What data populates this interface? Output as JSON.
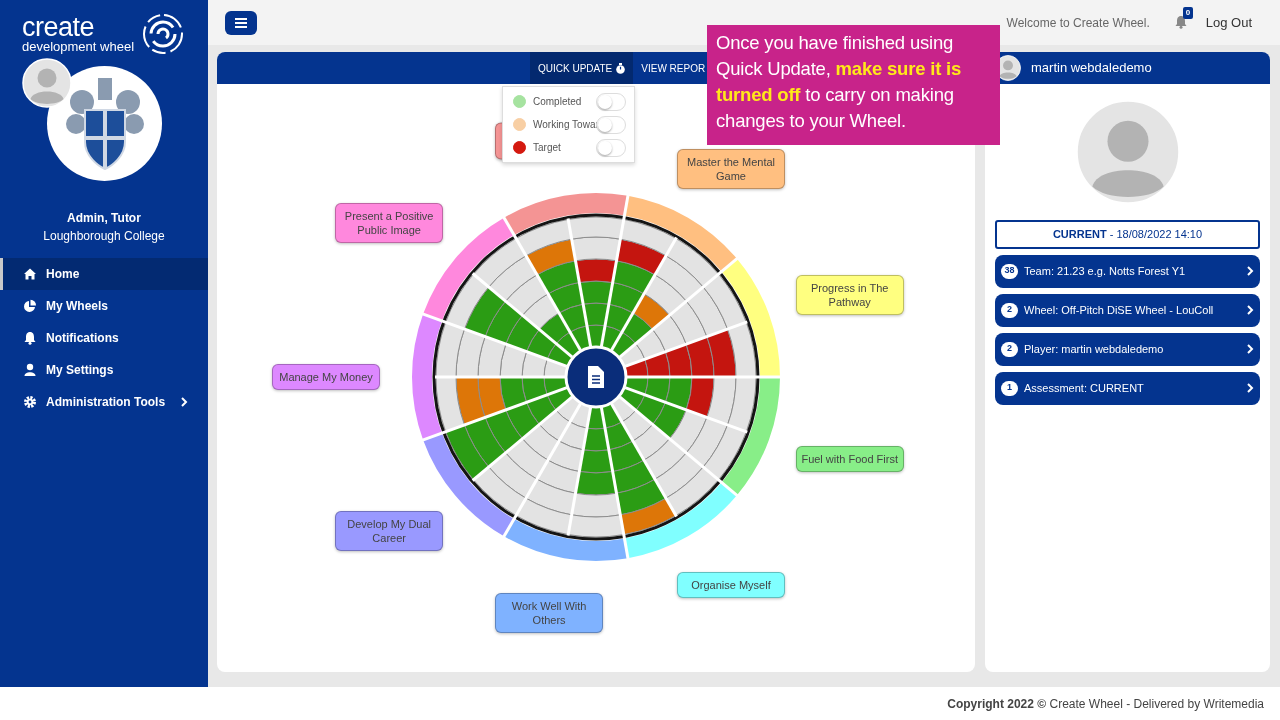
{
  "sidebar": {
    "logo": {
      "line_1": "create",
      "line_2": "development wheel"
    },
    "user": {
      "name": "Admin, Tutor",
      "organisation": "Loughborough College"
    },
    "items": [
      {
        "label": "Home",
        "kind": "home",
        "selected": true,
        "has_submenu": false
      },
      {
        "label": "My Wheels",
        "kind": "pie",
        "selected": false,
        "has_submenu": false
      },
      {
        "label": "Notifications",
        "kind": "bell",
        "selected": false,
        "has_submenu": false
      },
      {
        "label": "My Settings",
        "kind": "user",
        "selected": false,
        "has_submenu": false
      },
      {
        "label": "Administration Tools",
        "kind": "gear",
        "selected": false,
        "has_submenu": true
      }
    ]
  },
  "topbar": {
    "welcome": "Welcome to Create Wheel.",
    "notification_count": "0",
    "logout": "Log Out"
  },
  "card": {
    "tabs": [
      {
        "label": "QUICK UPDATE",
        "selected": true
      },
      {
        "label": "VIEW REPOR",
        "selected": false
      }
    ],
    "quick_update_menu": [
      {
        "label": "Completed",
        "color": "#a6e3a0",
        "on": false
      },
      {
        "label": "Working Towar",
        "color": "#f8cfa4",
        "on": false
      },
      {
        "label": "Target",
        "color": "#d4190f",
        "on": false
      }
    ]
  },
  "wheel": {
    "categories": [
      {
        "label": "Progress in The Pathway",
        "color": "#ffff80",
        "segments": [
          {
            "rings": [
              {
                "color": "#c4150f"
              },
              {
                "color": "#c4150f"
              },
              {
                "color": "#c4150f"
              },
              {
                "color": "#c4150f"
              },
              {
                "color": "#c4150f"
              },
              {
                "color": "#e3e3e3"
              }
            ]
          },
          {
            "rings": [
              {
                "color": "#e3e3e3"
              },
              {
                "color": "#e3e3e3"
              },
              {
                "color": "#e3e3e3"
              },
              {
                "color": "#e3e3e3"
              },
              {
                "color": "#e3e3e3"
              },
              {
                "color": "#e3e3e3"
              }
            ]
          }
        ]
      },
      {
        "label": "Master the Mental Game",
        "color": "#ffbf80",
        "segments": [
          {
            "rings": [
              {
                "color": "#2b9c14"
              },
              {
                "color": "#2b9c14"
              },
              {
                "color": "#dd7608"
              },
              {
                "color": "#e3e3e3"
              },
              {
                "color": "#e3e3e3"
              },
              {
                "color": "#e3e3e3"
              }
            ]
          },
          {
            "rings": [
              {
                "color": "#2b9c14"
              },
              {
                "color": "#2b9c14"
              },
              {
                "color": "#2b9c14"
              },
              {
                "color": "#2b9c14"
              },
              {
                "color": "#c4150f"
              },
              {
                "color": "#e3e3e3"
              }
            ]
          }
        ]
      },
      {
        "color": "#f49494",
        "segments": [
          {
            "rings": [
              {
                "color": "#2b9c14"
              },
              {
                "color": "#2b9c14"
              },
              {
                "color": "#2b9c14"
              },
              {
                "color": "#c4150f"
              },
              {
                "color": "#e3e3e3"
              },
              {
                "color": "#e3e3e3"
              }
            ]
          },
          {
            "rings": [
              {
                "color": "#2b9c14"
              },
              {
                "color": "#2b9c14"
              },
              {
                "color": "#2b9c14"
              },
              {
                "color": "#2b9c14"
              },
              {
                "color": "#dd7608"
              },
              {
                "color": "#e3e3e3"
              }
            ]
          }
        ]
      },
      {
        "label": "Present a Positive Public Image",
        "color": "#ff88dd",
        "segments": [
          {
            "rings": [
              {
                "color": "#2b9c14"
              },
              {
                "color": "#2b9c14"
              },
              {
                "color": "#e3e3e3"
              },
              {
                "color": "#e3e3e3"
              },
              {
                "color": "#e3e3e3"
              },
              {
                "color": "#e3e3e3"
              }
            ]
          },
          {
            "rings": [
              {
                "color": "#2b9c14"
              },
              {
                "color": "#2b9c14"
              },
              {
                "color": "#2b9c14"
              },
              {
                "color": "#2b9c14"
              },
              {
                "color": "#2b9c14"
              },
              {
                "color": "#e3e3e3"
              }
            ]
          }
        ]
      },
      {
        "label": "Manage My Money",
        "color": "#dd88ff",
        "segments": [
          {
            "rings": [
              {
                "color": "#e3e3e3"
              },
              {
                "color": "#e3e3e3"
              },
              {
                "color": "#e3e3e3"
              },
              {
                "color": "#e3e3e3"
              },
              {
                "color": "#e3e3e3"
              },
              {
                "color": "#e3e3e3"
              }
            ]
          },
          {
            "rings": [
              {
                "color": "#2b9c14"
              },
              {
                "color": "#2b9c14"
              },
              {
                "color": "#2b9c14"
              },
              {
                "color": "#dd7608"
              },
              {
                "color": "#dd7608"
              },
              {
                "color": "#e3e3e3"
              }
            ]
          }
        ]
      },
      {
        "label": "Develop My Dual Career",
        "color": "#9999ff",
        "segments": [
          {
            "rings": [
              {
                "color": "#2b9c14"
              },
              {
                "color": "#2b9c14"
              },
              {
                "color": "#2b9c14"
              },
              {
                "color": "#2b9c14"
              },
              {
                "color": "#2b9c14"
              },
              {
                "color": "#2b9c14"
              }
            ]
          },
          {
            "rings": [
              {
                "color": "#e3e3e3"
              },
              {
                "color": "#e3e3e3"
              },
              {
                "color": "#e3e3e3"
              },
              {
                "color": "#e3e3e3"
              },
              {
                "color": "#e3e3e3"
              },
              {
                "color": "#e3e3e3"
              }
            ]
          }
        ]
      },
      {
        "label": "Work Well With Others",
        "color": "#7fb2ff",
        "segments": [
          {
            "rings": [
              {
                "color": "#e3e3e3"
              },
              {
                "color": "#e3e3e3"
              },
              {
                "color": "#e3e3e3"
              },
              {
                "color": "#e3e3e3"
              },
              {
                "color": "#e3e3e3"
              },
              {
                "color": "#e3e3e3"
              }
            ]
          },
          {
            "rings": [
              {
                "color": "#2b9c14"
              },
              {
                "color": "#2b9c14"
              },
              {
                "color": "#2b9c14"
              },
              {
                "color": "#2b9c14"
              },
              {
                "color": "#e3e3e3"
              },
              {
                "color": "#e3e3e3"
              }
            ]
          }
        ]
      },
      {
        "label": "Organise Myself",
        "color": "#80ffff",
        "segments": [
          {
            "rings": [
              {
                "color": "#2b9c14"
              },
              {
                "color": "#2b9c14"
              },
              {
                "color": "#2b9c14"
              },
              {
                "color": "#2b9c14"
              },
              {
                "color": "#2b9c14"
              },
              {
                "color": "#dd7608"
              }
            ]
          },
          {
            "rings": [
              {
                "color": "#e3e3e3"
              },
              {
                "color": "#e3e3e3"
              },
              {
                "color": "#e3e3e3"
              },
              {
                "color": "#e3e3e3"
              },
              {
                "color": "#e3e3e3"
              },
              {
                "color": "#e3e3e3"
              }
            ]
          }
        ]
      },
      {
        "label": "Fuel with Food First",
        "color": "#88ee88",
        "segments": [
          {
            "rings": [
              {
                "color": "#2b9c14"
              },
              {
                "color": "#2b9c14"
              },
              {
                "color": "#2b9c14"
              },
              {
                "color": "#e3e3e3"
              },
              {
                "color": "#e3e3e3"
              },
              {
                "color": "#e3e3e3"
              }
            ]
          },
          {
            "rings": [
              {
                "color": "#2b9c14"
              },
              {
                "color": "#2b9c14"
              },
              {
                "color": "#2b9c14"
              },
              {
                "color": "#c4150f"
              },
              {
                "color": "#e3e3e3"
              },
              {
                "color": "#e3e3e3"
              }
            ]
          }
        ]
      }
    ]
  },
  "profile": {
    "name": "martin webdaledemo",
    "assessment": "**CURRENT** - 18/08/2022 14:10",
    "filters": [
      {
        "count": "38",
        "label": "Team: 21.23 e.g. Notts Forest Y1"
      },
      {
        "count": "2",
        "label": "Wheel: Off-Pitch DiSE Wheel - LouColl"
      },
      {
        "count": "2",
        "label": "Player: martin webdaledemo"
      },
      {
        "count": "1",
        "label": "Assessment: CURRENT"
      }
    ]
  },
  "callout": {
    "text": "Once you have finished using Quick Update, **make sure it is turned off** to carry on making changes to your Wheel."
  },
  "footer": {
    "text": "**Copyright 2022 ©** Create Wheel - Delivered by Writemedia"
  }
}
